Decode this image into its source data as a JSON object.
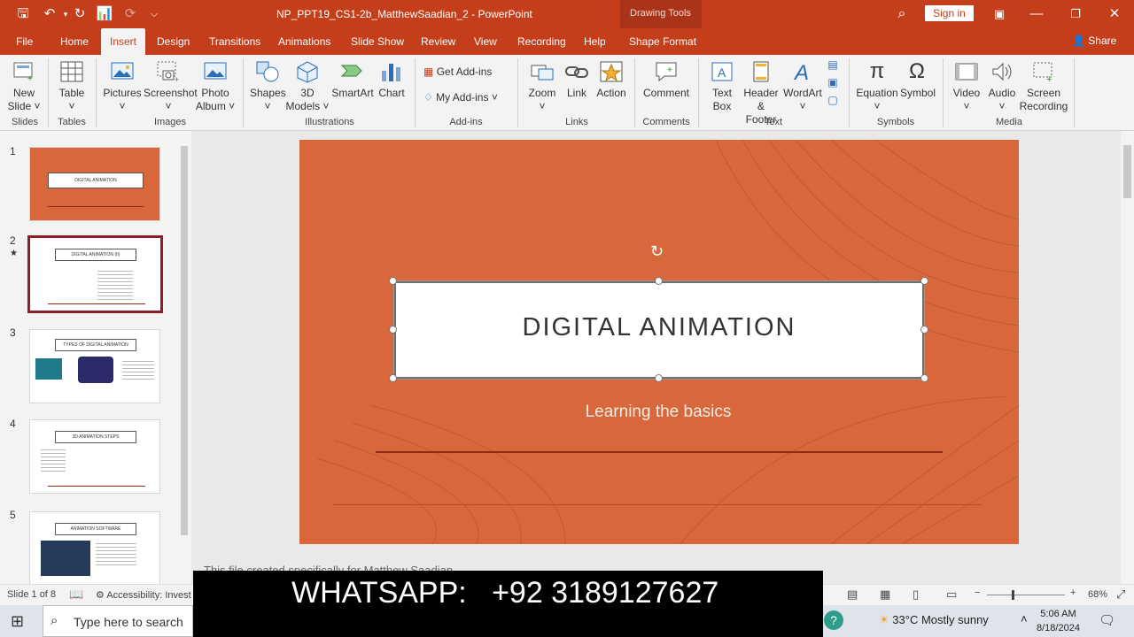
{
  "window": {
    "doc_title": "NP_PPT19_CS1-2b_MatthewSaadian_2  -  PowerPoint",
    "context_group": "Drawing Tools",
    "sign_in": "Sign in",
    "share": "Share"
  },
  "tabs": [
    "File",
    "Home",
    "Insert",
    "Design",
    "Transitions",
    "Animations",
    "Slide Show",
    "Review",
    "View",
    "Recording",
    "Help",
    "Shape Format"
  ],
  "active_tab": "Insert",
  "ribbon": {
    "new_slide": [
      "New",
      "Slide ˅"
    ],
    "table": "Table",
    "pictures": "Pictures",
    "screenshot": "Screenshot",
    "photo_album": [
      "Photo",
      "Album ˅"
    ],
    "shapes": "Shapes",
    "models": [
      "3D",
      "Models ˅"
    ],
    "smartart": "SmartArt",
    "chart": "Chart",
    "get_addins": "Get Add-ins",
    "my_addins": "My Add-ins",
    "zoom": "Zoom",
    "link": "Link",
    "action": "Action",
    "comment": "Comment",
    "text_box": [
      "Text",
      "Box"
    ],
    "header_footer": [
      "Header",
      "& Footer"
    ],
    "wordart": "WordArt",
    "equation": "Equation",
    "symbol": "Symbol",
    "video": "Video",
    "audio": "Audio",
    "screen_recording": [
      "Screen",
      "Recording"
    ],
    "group_labels": {
      "slides": "Slides",
      "tables": "Tables",
      "images": "Images",
      "illustrations": "Illustrations",
      "addins": "Add-ins",
      "links": "Links",
      "comments": "Comments",
      "text": "Text",
      "symbols": "Symbols",
      "media": "Media"
    }
  },
  "thumbnails": [
    {
      "num": "1",
      "title": "DIGITAL ANIMATION"
    },
    {
      "num": "2",
      "title": "DIGITAL ANIMATION (II)",
      "star": "★"
    },
    {
      "num": "3",
      "title": "TYPES OF DIGITAL ANIMATION"
    },
    {
      "num": "4",
      "title": "3D ANIMATION STEPS"
    },
    {
      "num": "5",
      "title": "ANIMATION SOFTWARE"
    }
  ],
  "slide": {
    "title": "DIGITAL ANIMATION",
    "subtitle": "Learning the basics"
  },
  "notes": "This file created specifically for Matthew Saadian",
  "status": {
    "slide_count": "Slide 1 of 8",
    "accessibility": "Accessibility: Invest",
    "zoom": "68%"
  },
  "overlay": {
    "whatsapp": "WHATSAPP:   +92 3189127627"
  },
  "taskbar": {
    "search_placeholder": "Type here to search",
    "weather": "33°C  Mostly sunny",
    "time": "5:06 AM",
    "date": "8/18/2024"
  },
  "colors": {
    "accent": "#c43e1c",
    "slide_bg": "#d8683b",
    "selected_thumb_border": "#8e1f2a"
  }
}
